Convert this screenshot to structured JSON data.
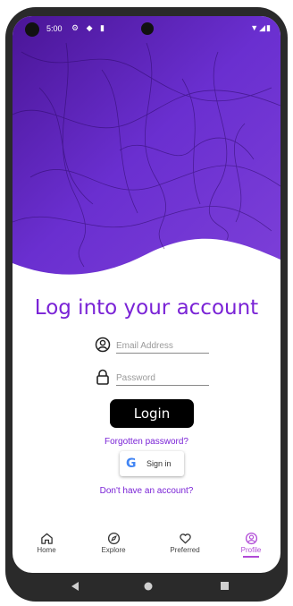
{
  "status_bar": {
    "time": "5:00",
    "left_icons": "⚙ ◆ ▮",
    "right_icons": "▼◢▮"
  },
  "title": "Log into your account",
  "email": {
    "placeholder": "Email Address"
  },
  "password": {
    "placeholder": "Password"
  },
  "login_label": "Login",
  "forgot_label": "Forgotten password?",
  "google": {
    "g": "G",
    "label": "Sign in"
  },
  "signup_label": "Don't have an account?",
  "nav": [
    {
      "label": "Home",
      "icon": "home-icon"
    },
    {
      "label": "Explore",
      "icon": "compass-icon"
    },
    {
      "label": "Preferred",
      "icon": "heart-icon"
    },
    {
      "label": "Profile",
      "icon": "profile-icon"
    }
  ],
  "colors": {
    "accent": "#7a23d6",
    "hero_dark": "#3c0f80",
    "hero_light": "#8a4fe0",
    "nav_active": "#b04ad6"
  }
}
